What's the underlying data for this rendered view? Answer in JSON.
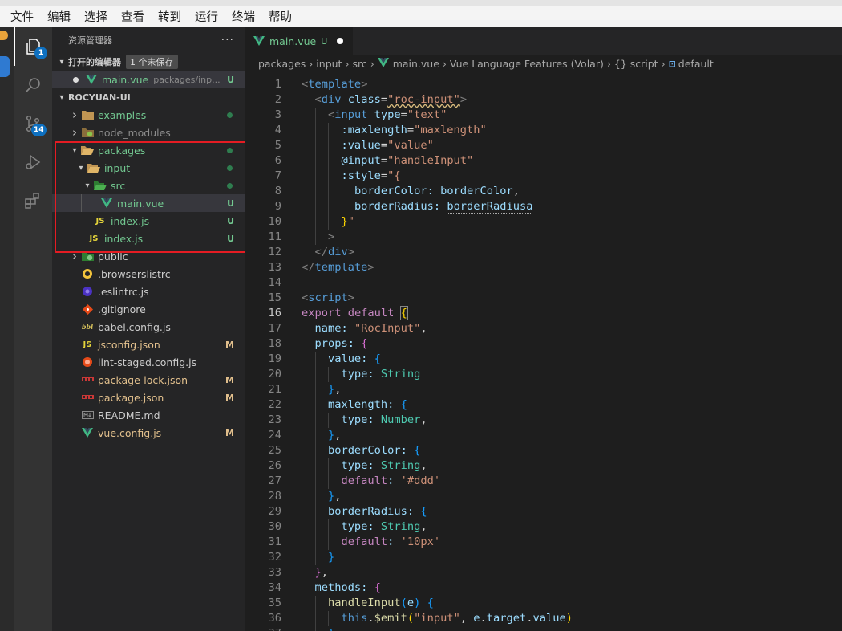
{
  "menu": [
    "文件",
    "编辑",
    "选择",
    "查看",
    "转到",
    "运行",
    "终端",
    "帮助"
  ],
  "activity_bar": {
    "explorer_badge": "1",
    "scm_badge": "14"
  },
  "explorer": {
    "title": "资源管理器",
    "more": "···",
    "open_editors": {
      "title": "打开的编辑器",
      "unsaved": "1 个未保存",
      "item": {
        "name": "main.vue",
        "path": "packages/inp...",
        "status": "U"
      }
    },
    "project": {
      "title": "ROCYUAN-UI",
      "files": [
        {
          "name": "examples",
          "type": "folder",
          "status": "dot"
        },
        {
          "name": "node_modules",
          "type": "folder-node",
          "status": ""
        },
        {
          "name": "packages",
          "type": "folder-open",
          "status": "dot"
        },
        {
          "name": "input",
          "type": "folder-open",
          "status": "dot"
        },
        {
          "name": "src",
          "type": "folder-src",
          "status": "dot"
        },
        {
          "name": "main.vue",
          "type": "vue",
          "status": "U"
        },
        {
          "name": "index.js",
          "type": "js",
          "status": "U"
        },
        {
          "name": "index.js",
          "type": "js",
          "status": "U"
        },
        {
          "name": "public",
          "type": "folder-public",
          "status": ""
        },
        {
          "name": ".browserslistrc",
          "type": "browserslist",
          "status": ""
        },
        {
          "name": ".eslintrc.js",
          "type": "eslint",
          "status": ""
        },
        {
          "name": ".gitignore",
          "type": "git",
          "status": ""
        },
        {
          "name": "babel.config.js",
          "type": "babel",
          "status": ""
        },
        {
          "name": "jsconfig.json",
          "type": "js",
          "status": "M"
        },
        {
          "name": "lint-staged.config.js",
          "type": "lint",
          "status": ""
        },
        {
          "name": "package-lock.json",
          "type": "npm",
          "status": "M"
        },
        {
          "name": "package.json",
          "type": "npm",
          "status": "M"
        },
        {
          "name": "README.md",
          "type": "md",
          "status": ""
        },
        {
          "name": "vue.config.js",
          "type": "vue",
          "status": "M"
        }
      ]
    }
  },
  "editor": {
    "tab": {
      "name": "main.vue",
      "status": "U"
    },
    "breadcrumb": [
      "packages",
      "input",
      "src",
      "main.vue",
      "Vue Language Features (Volar)",
      "{} script",
      "default"
    ],
    "current_line": 16,
    "lines": [
      "<template>",
      "  <div class=\"roc-input\">",
      "    <input type=\"text\"",
      "      :maxlength=\"maxlength\"",
      "      :value=\"value\"",
      "      @input=\"handleInput\"",
      "      :style=\"{",
      "        borderColor: borderColor,",
      "        borderRadius: borderRadiusa",
      "      }\"",
      "    >",
      "  </div>",
      "</template>",
      "",
      "<script>",
      "export default {",
      "  name: \"RocInput\",",
      "  props: {",
      "    value: {",
      "      type: String",
      "    },",
      "    maxlength: {",
      "      type: Number,",
      "    },",
      "    borderColor: {",
      "      type: String,",
      "      default: '#ddd'",
      "    },",
      "    borderRadius: {",
      "      type: String,",
      "      default: '10px'",
      "    }",
      "  },",
      "  methods: {",
      "    handleInput(e) {",
      "      this.$emit(\"input\", e.target.value)",
      "    }"
    ]
  }
}
